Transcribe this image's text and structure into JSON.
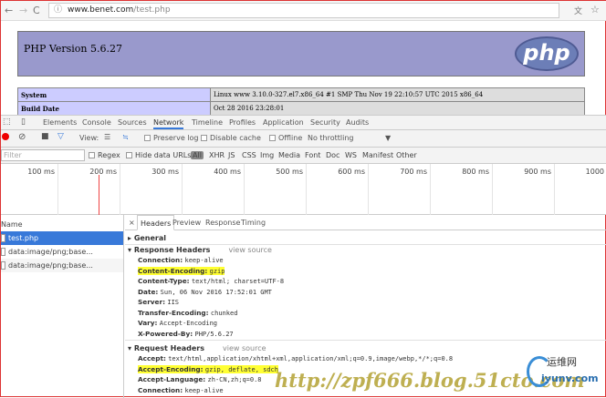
{
  "browser": {
    "url_host": "www.benet.com",
    "url_path": "/test.php"
  },
  "php": {
    "version_title": "PHP Version 5.6.27",
    "logo_text": "php",
    "rows": [
      {
        "key": "System",
        "value": "Linux www 3.10.0-327.el7.x86_64 #1 SMP Thu Nov 19 22:10:57 UTC 2015 x86_64"
      },
      {
        "key": "Build Date",
        "value": "Oct 28 2016 23:28:01"
      }
    ]
  },
  "devtools": {
    "tabs": [
      "Elements",
      "Console",
      "Sources",
      "Network",
      "Timeline",
      "Profiles",
      "Application",
      "Security",
      "Audits"
    ],
    "toolbar": {
      "view_label": "View:",
      "preserve_log": "Preserve log",
      "disable_cache": "Disable cache",
      "offline": "Offline",
      "throttling": "No throttling"
    },
    "filter": {
      "placeholder": "Filter",
      "regex": "Regex",
      "hide_data_urls": "Hide data URLs",
      "all": "All",
      "types": [
        "XHR",
        "JS",
        "CSS",
        "Img",
        "Media",
        "Font",
        "Doc",
        "WS",
        "Manifest",
        "Other"
      ]
    },
    "ruler": [
      "100 ms",
      "200 ms",
      "300 ms",
      "400 ms",
      "500 ms",
      "600 ms",
      "700 ms",
      "800 ms",
      "900 ms",
      "1000"
    ],
    "list": {
      "header": "Name",
      "items": [
        "test.php",
        "data:image/png;base...",
        "data:image/png;base..."
      ]
    },
    "detail_tabs": [
      "Headers",
      "Preview",
      "Response",
      "Timing"
    ],
    "general": "General",
    "response_headers": {
      "title": "Response Headers",
      "view_source": "view source",
      "items": [
        {
          "k": "Connection:",
          "v": "keep-alive"
        },
        {
          "k": "Content-Encoding:",
          "v": "gzip"
        },
        {
          "k": "Content-Type:",
          "v": "text/html; charset=UTF-8"
        },
        {
          "k": "Date:",
          "v": "Sun, 06 Nov 2016 17:52:01 GMT"
        },
        {
          "k": "Server:",
          "v": "IIS"
        },
        {
          "k": "Transfer-Encoding:",
          "v": "chunked"
        },
        {
          "k": "Vary:",
          "v": "Accept-Encoding"
        },
        {
          "k": "X-Powered-By:",
          "v": "PHP/5.6.27"
        }
      ]
    },
    "request_headers": {
      "title": "Request Headers",
      "view_source": "view source",
      "items": [
        {
          "k": "Accept:",
          "v": "text/html,application/xhtml+xml,application/xml;q=0.9,image/webp,*/*;q=0.8"
        },
        {
          "k": "Accept-Encoding:",
          "v": "gzip, deflate, sdch"
        },
        {
          "k": "Accept-Language:",
          "v": "zh-CN,zh;q=0.8"
        },
        {
          "k": "Connection:",
          "v": "keep-alive"
        }
      ]
    }
  },
  "watermark": {
    "url": "http://zpf666.blog.51cto.com",
    "logo_cn": "运维网",
    "logo_en": "iyunv.com"
  },
  "colors": {
    "highlight": "#ffff33",
    "selected": "#3879d9",
    "php_banner": "#9999cc"
  }
}
